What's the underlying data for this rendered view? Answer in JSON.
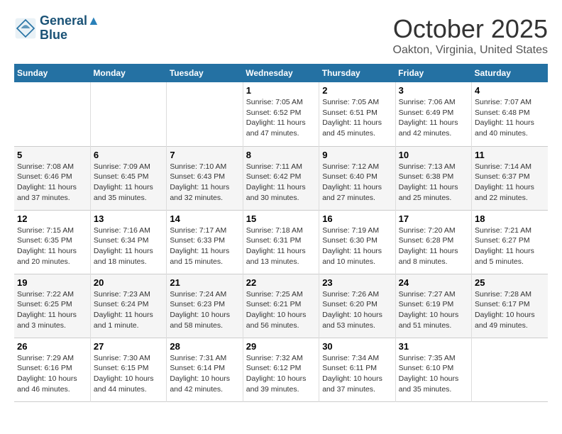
{
  "header": {
    "logo_line1": "General",
    "logo_line2": "Blue",
    "month": "October 2025",
    "location": "Oakton, Virginia, United States"
  },
  "weekdays": [
    "Sunday",
    "Monday",
    "Tuesday",
    "Wednesday",
    "Thursday",
    "Friday",
    "Saturday"
  ],
  "weeks": [
    [
      {
        "day": "",
        "info": ""
      },
      {
        "day": "",
        "info": ""
      },
      {
        "day": "",
        "info": ""
      },
      {
        "day": "1",
        "info": "Sunrise: 7:05 AM\nSunset: 6:52 PM\nDaylight: 11 hours\nand 47 minutes."
      },
      {
        "day": "2",
        "info": "Sunrise: 7:05 AM\nSunset: 6:51 PM\nDaylight: 11 hours\nand 45 minutes."
      },
      {
        "day": "3",
        "info": "Sunrise: 7:06 AM\nSunset: 6:49 PM\nDaylight: 11 hours\nand 42 minutes."
      },
      {
        "day": "4",
        "info": "Sunrise: 7:07 AM\nSunset: 6:48 PM\nDaylight: 11 hours\nand 40 minutes."
      }
    ],
    [
      {
        "day": "5",
        "info": "Sunrise: 7:08 AM\nSunset: 6:46 PM\nDaylight: 11 hours\nand 37 minutes."
      },
      {
        "day": "6",
        "info": "Sunrise: 7:09 AM\nSunset: 6:45 PM\nDaylight: 11 hours\nand 35 minutes."
      },
      {
        "day": "7",
        "info": "Sunrise: 7:10 AM\nSunset: 6:43 PM\nDaylight: 11 hours\nand 32 minutes."
      },
      {
        "day": "8",
        "info": "Sunrise: 7:11 AM\nSunset: 6:42 PM\nDaylight: 11 hours\nand 30 minutes."
      },
      {
        "day": "9",
        "info": "Sunrise: 7:12 AM\nSunset: 6:40 PM\nDaylight: 11 hours\nand 27 minutes."
      },
      {
        "day": "10",
        "info": "Sunrise: 7:13 AM\nSunset: 6:38 PM\nDaylight: 11 hours\nand 25 minutes."
      },
      {
        "day": "11",
        "info": "Sunrise: 7:14 AM\nSunset: 6:37 PM\nDaylight: 11 hours\nand 22 minutes."
      }
    ],
    [
      {
        "day": "12",
        "info": "Sunrise: 7:15 AM\nSunset: 6:35 PM\nDaylight: 11 hours\nand 20 minutes."
      },
      {
        "day": "13",
        "info": "Sunrise: 7:16 AM\nSunset: 6:34 PM\nDaylight: 11 hours\nand 18 minutes."
      },
      {
        "day": "14",
        "info": "Sunrise: 7:17 AM\nSunset: 6:33 PM\nDaylight: 11 hours\nand 15 minutes."
      },
      {
        "day": "15",
        "info": "Sunrise: 7:18 AM\nSunset: 6:31 PM\nDaylight: 11 hours\nand 13 minutes."
      },
      {
        "day": "16",
        "info": "Sunrise: 7:19 AM\nSunset: 6:30 PM\nDaylight: 11 hours\nand 10 minutes."
      },
      {
        "day": "17",
        "info": "Sunrise: 7:20 AM\nSunset: 6:28 PM\nDaylight: 11 hours\nand 8 minutes."
      },
      {
        "day": "18",
        "info": "Sunrise: 7:21 AM\nSunset: 6:27 PM\nDaylight: 11 hours\nand 5 minutes."
      }
    ],
    [
      {
        "day": "19",
        "info": "Sunrise: 7:22 AM\nSunset: 6:25 PM\nDaylight: 11 hours\nand 3 minutes."
      },
      {
        "day": "20",
        "info": "Sunrise: 7:23 AM\nSunset: 6:24 PM\nDaylight: 11 hours\nand 1 minute."
      },
      {
        "day": "21",
        "info": "Sunrise: 7:24 AM\nSunset: 6:23 PM\nDaylight: 10 hours\nand 58 minutes."
      },
      {
        "day": "22",
        "info": "Sunrise: 7:25 AM\nSunset: 6:21 PM\nDaylight: 10 hours\nand 56 minutes."
      },
      {
        "day": "23",
        "info": "Sunrise: 7:26 AM\nSunset: 6:20 PM\nDaylight: 10 hours\nand 53 minutes."
      },
      {
        "day": "24",
        "info": "Sunrise: 7:27 AM\nSunset: 6:19 PM\nDaylight: 10 hours\nand 51 minutes."
      },
      {
        "day": "25",
        "info": "Sunrise: 7:28 AM\nSunset: 6:17 PM\nDaylight: 10 hours\nand 49 minutes."
      }
    ],
    [
      {
        "day": "26",
        "info": "Sunrise: 7:29 AM\nSunset: 6:16 PM\nDaylight: 10 hours\nand 46 minutes."
      },
      {
        "day": "27",
        "info": "Sunrise: 7:30 AM\nSunset: 6:15 PM\nDaylight: 10 hours\nand 44 minutes."
      },
      {
        "day": "28",
        "info": "Sunrise: 7:31 AM\nSunset: 6:14 PM\nDaylight: 10 hours\nand 42 minutes."
      },
      {
        "day": "29",
        "info": "Sunrise: 7:32 AM\nSunset: 6:12 PM\nDaylight: 10 hours\nand 39 minutes."
      },
      {
        "day": "30",
        "info": "Sunrise: 7:34 AM\nSunset: 6:11 PM\nDaylight: 10 hours\nand 37 minutes."
      },
      {
        "day": "31",
        "info": "Sunrise: 7:35 AM\nSunset: 6:10 PM\nDaylight: 10 hours\nand 35 minutes."
      },
      {
        "day": "",
        "info": ""
      }
    ]
  ]
}
